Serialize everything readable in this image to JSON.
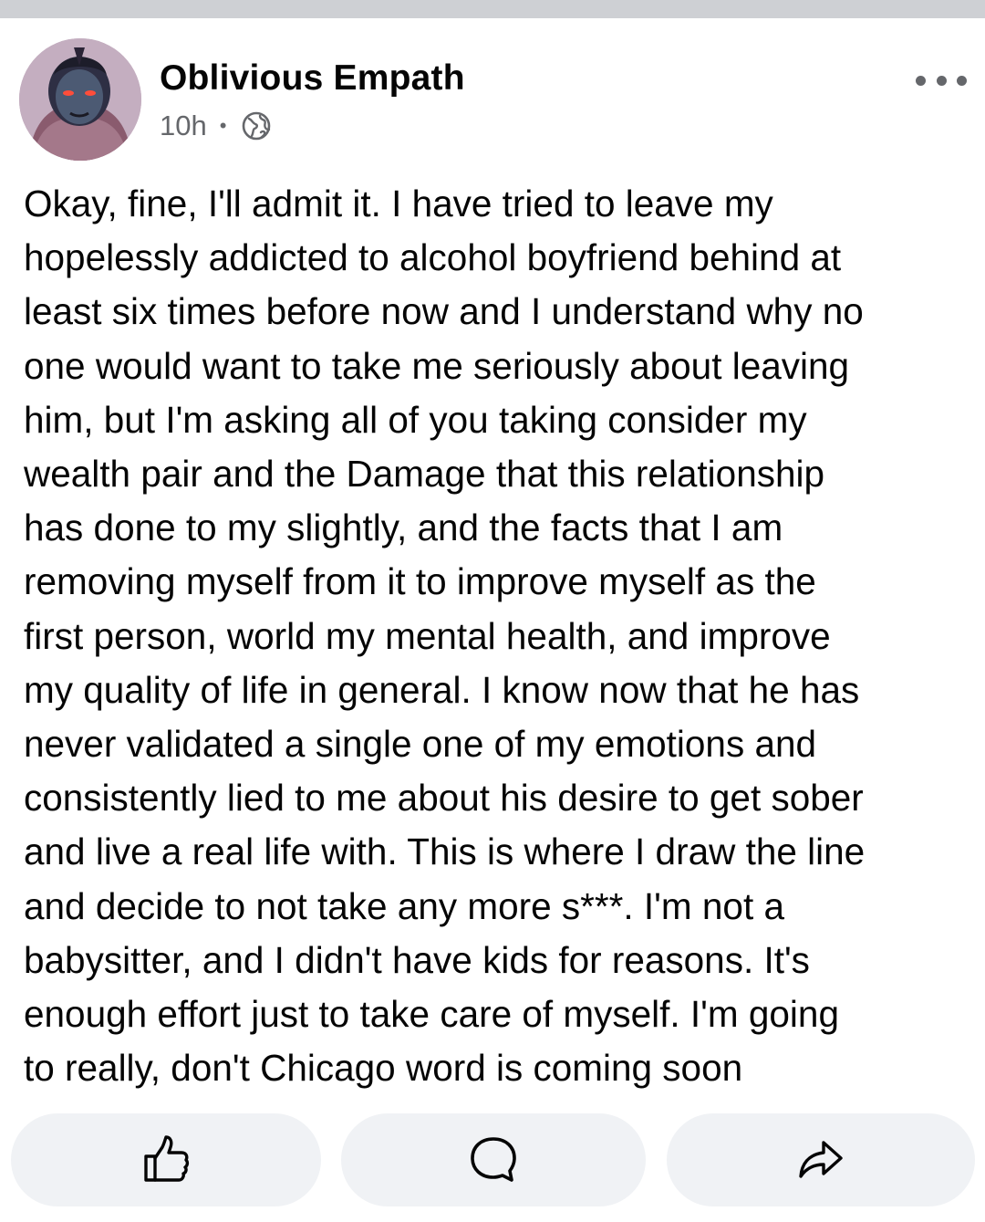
{
  "post": {
    "author": "Oblivious Empath",
    "timestamp": "10h",
    "separator": "•",
    "audience_icon": "globe-icon",
    "more_icon": "more-options-icon",
    "body": "Okay, fine, I'll admit it. I have tried to leave my\nhopelessly addicted to alcohol boyfriend behind at\nleast six times before now and I understand why no\none would want to take me seriously about leaving\nhim, but I'm asking all of you taking consider my\nwealth pair and the Damage that this relationship\nhas done to my slightly, and the facts that I am\nremoving myself from it to improve myself as the\nfirst person, world my mental health, and improve\nmy quality of life in general. I know now that he has\nnever validated a single one of my emotions and\nconsistently lied to me about his desire to get sober\nand live a real life with. This is where I draw the line\nand decide to not take any more s***. I'm not a\nbabysitter, and I didn't have kids for reasons. It's\nenough effort just to take care of myself. I'm going\nto really, don't Chicago word is coming soon"
  },
  "actions": [
    {
      "name": "like",
      "icon": "thumbs-up-icon"
    },
    {
      "name": "comment",
      "icon": "comment-icon"
    },
    {
      "name": "share",
      "icon": "share-icon"
    }
  ],
  "colors": {
    "text_primary": "#050505",
    "text_secondary": "#65676b",
    "button_background": "#f0f2f5",
    "top_strip": "#ced0d4"
  }
}
